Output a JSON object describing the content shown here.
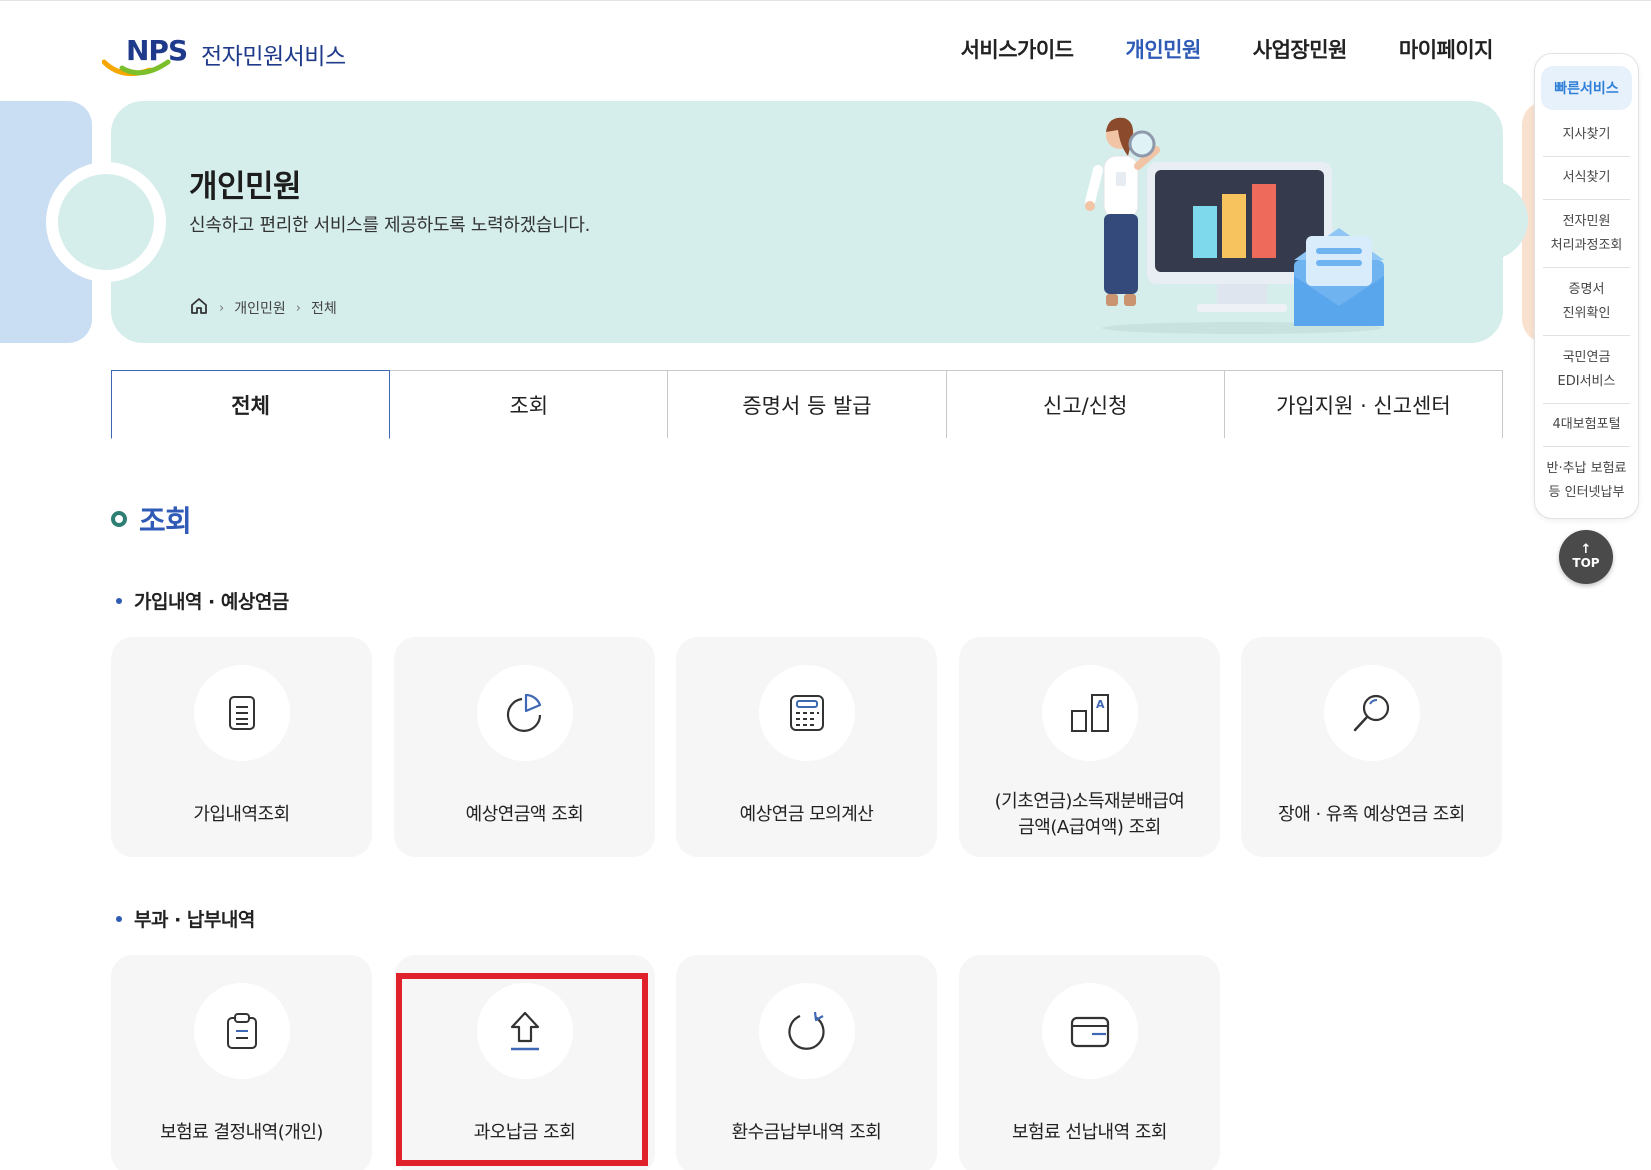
{
  "header": {
    "logo_mark": "NPS",
    "logo_text": "전자민원서비스",
    "nav": [
      "서비스가이드",
      "개인민원",
      "사업장민원",
      "마이페이지"
    ],
    "nav_active": "개인민원"
  },
  "hero": {
    "title": "개인민원",
    "subtitle": "신속하고 편리한 서비스를 제공하도록 노력하겠습니다.",
    "breadcrumb": [
      "개인민원",
      "전체"
    ]
  },
  "tabs": [
    "전체",
    "조회",
    "증명서 등 발급",
    "신고/신청",
    "가입지원 · 신고센터"
  ],
  "active_tab": "전체",
  "section": {
    "title": "조회",
    "groups": [
      {
        "title": "가입내역 · 예상연금",
        "items": [
          {
            "label": "가입내역조회",
            "icon": "document-list-icon"
          },
          {
            "label": "예상연금액 조회",
            "icon": "pie-chart-icon"
          },
          {
            "label": "예상연금 모의계산",
            "icon": "calculator-icon"
          },
          {
            "label": "(기초연금)소득재분배급여\n금액(A급여액) 조회",
            "icon": "bar-compare-icon"
          },
          {
            "label": "장애 · 유족 예상연금 조회",
            "icon": "magnifier-icon"
          }
        ]
      },
      {
        "title": "부과 · 납부내역",
        "items": [
          {
            "label": "보험료 결정내역(개인)",
            "icon": "clipboard-icon"
          },
          {
            "label": "과오납금 조회",
            "icon": "upload-arrow-icon",
            "highlighted": true
          },
          {
            "label": "환수금납부내역 조회",
            "icon": "refresh-icon"
          },
          {
            "label": "보험료 선납내역 조회",
            "icon": "wallet-icon"
          }
        ]
      }
    ]
  },
  "quick_menu": {
    "title": "빠른서비스",
    "items": [
      "지사찾기",
      "서식찾기",
      "전자민원\n처리과정조회",
      "증명서\n진위확인",
      "국민연금\nEDI서비스",
      "4대보험포털",
      "반·추납 보험료\n등 인터넷납부"
    ],
    "top_label": "TOP"
  },
  "colors": {
    "brand_blue": "#2f5bb7",
    "hero_bg": "#d5eeec",
    "card_bg": "#f6f6f6",
    "highlight": "#e0202b"
  }
}
